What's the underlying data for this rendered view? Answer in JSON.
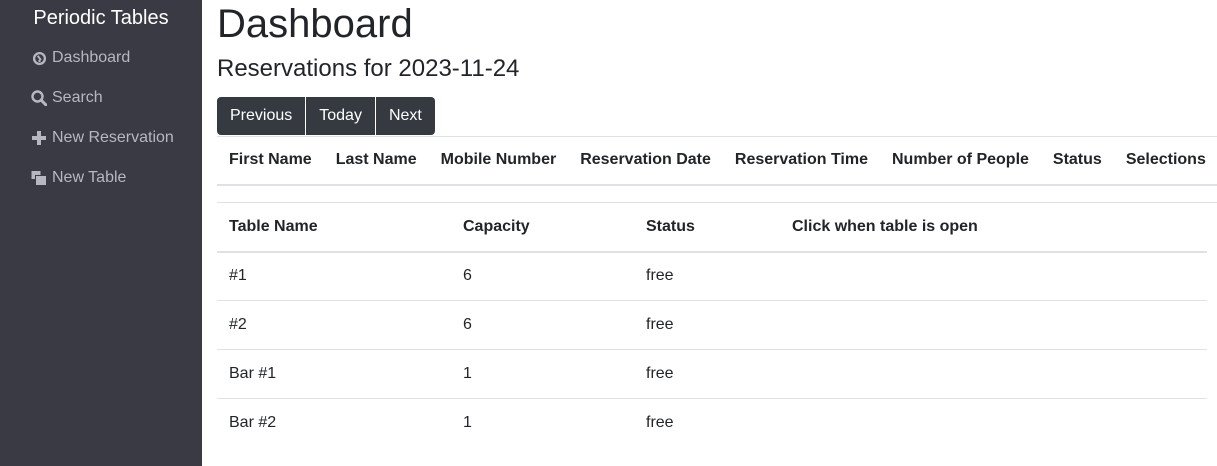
{
  "sidebar": {
    "brand": "Periodic Tables",
    "items": [
      {
        "label": "Dashboard",
        "icon": "dashboard-icon"
      },
      {
        "label": "Search",
        "icon": "search-icon"
      },
      {
        "label": "New Reservation",
        "icon": "plus-icon"
      },
      {
        "label": "New Table",
        "icon": "layers-icon"
      }
    ]
  },
  "main": {
    "title": "Dashboard",
    "subtitle": "Reservations for 2023-11-24",
    "buttons": {
      "previous": "Previous",
      "today": "Today",
      "next": "Next"
    },
    "reservations_table": {
      "headers": [
        "First Name",
        "Last Name",
        "Mobile Number",
        "Reservation Date",
        "Reservation Time",
        "Number of People",
        "Status",
        "Selections"
      ],
      "rows": []
    },
    "tables_table": {
      "headers": [
        "Table Name",
        "Capacity",
        "Status",
        "Click when table is open"
      ],
      "rows": [
        {
          "name": "#1",
          "capacity": "6",
          "status": "free"
        },
        {
          "name": "#2",
          "capacity": "6",
          "status": "free"
        },
        {
          "name": "Bar #1",
          "capacity": "1",
          "status": "free"
        },
        {
          "name": "Bar #2",
          "capacity": "1",
          "status": "free"
        }
      ]
    }
  },
  "colors": {
    "sidebar_bg": "#3a3a45",
    "button_bg": "#343a40",
    "nav_text": "#b6b7bf"
  }
}
